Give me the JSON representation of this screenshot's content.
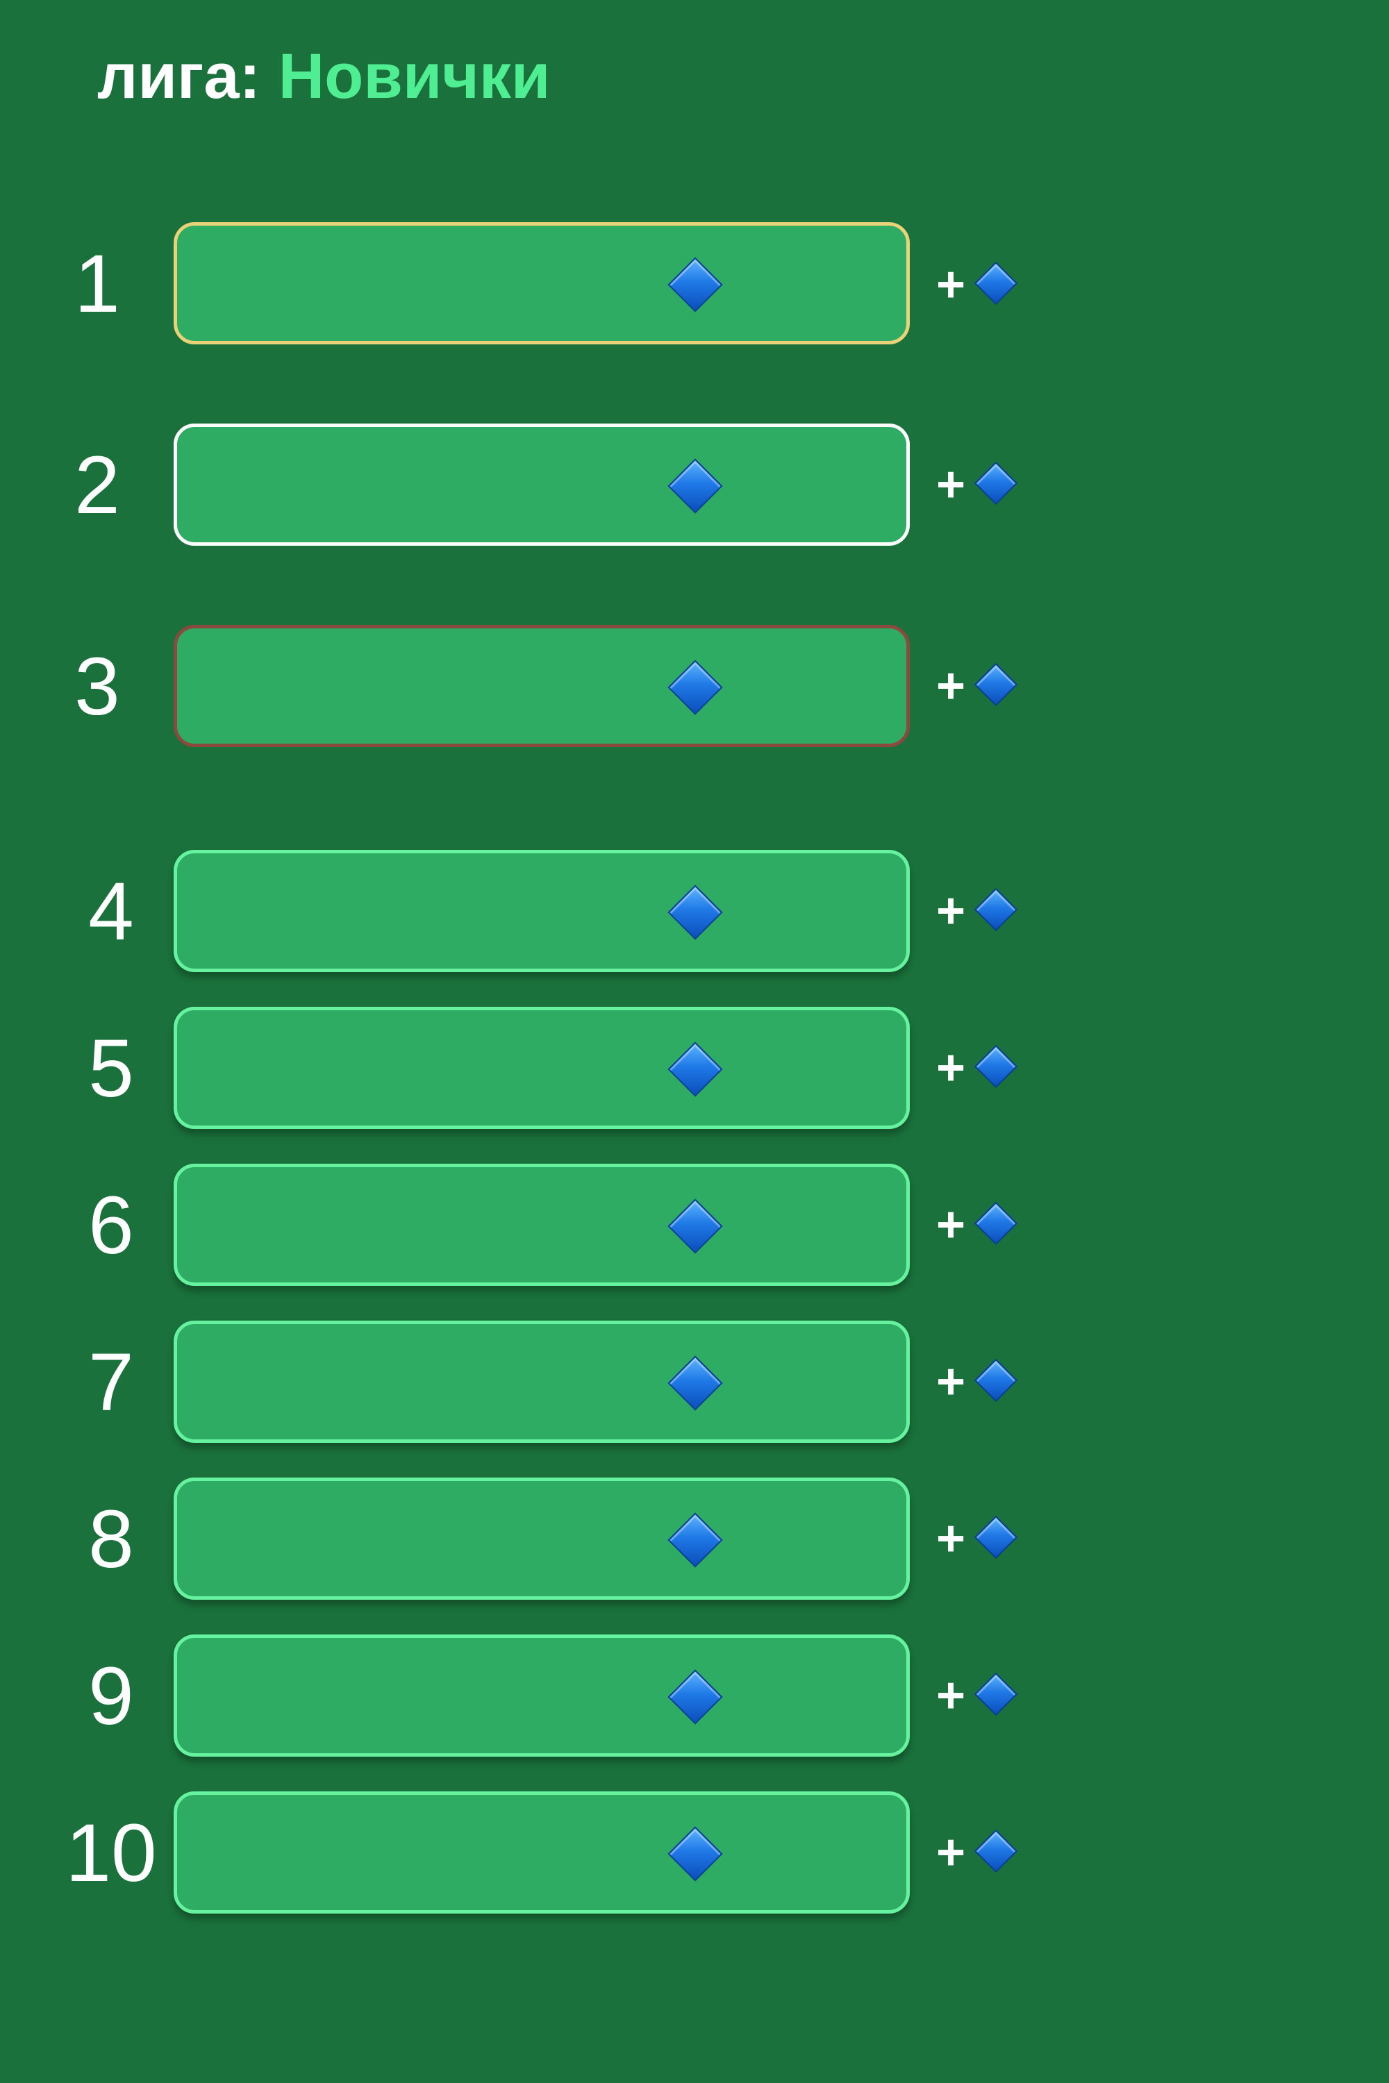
{
  "header": {
    "prefix": "лига:",
    "league_name": "Новички"
  },
  "colors": {
    "background": "#1a713b",
    "row_fill": "#2fac63",
    "row_border_default": "#66f29f",
    "row_border_gold": "#e9d277",
    "row_border_silver": "#ffffff",
    "row_border_bronze": "#8c4a3f",
    "league_name": "#4fee92"
  },
  "leaderboard": {
    "rows": [
      {
        "rank": "1",
        "name": "",
        "reward_prefix": "+",
        "reward_amount": "",
        "icon": "diamond-icon",
        "style": "gold"
      },
      {
        "rank": "2",
        "name": "",
        "reward_prefix": "+",
        "reward_amount": "",
        "icon": "diamond-icon",
        "style": "silver"
      },
      {
        "rank": "3",
        "name": "",
        "reward_prefix": "+",
        "reward_amount": "",
        "icon": "diamond-icon",
        "style": "bronze"
      },
      {
        "rank": "4",
        "name": "",
        "reward_prefix": "+",
        "reward_amount": "",
        "icon": "diamond-icon",
        "style": "default"
      },
      {
        "rank": "5",
        "name": "",
        "reward_prefix": "+",
        "reward_amount": "",
        "icon": "diamond-icon",
        "style": "default"
      },
      {
        "rank": "6",
        "name": "",
        "reward_prefix": "+",
        "reward_amount": "",
        "icon": "diamond-icon",
        "style": "default"
      },
      {
        "rank": "7",
        "name": "",
        "reward_prefix": "+",
        "reward_amount": "",
        "icon": "diamond-icon",
        "style": "default"
      },
      {
        "rank": "8",
        "name": "",
        "reward_prefix": "+",
        "reward_amount": "",
        "icon": "diamond-icon",
        "style": "default"
      },
      {
        "rank": "9",
        "name": "",
        "reward_prefix": "+",
        "reward_amount": "",
        "icon": "diamond-icon",
        "style": "default"
      },
      {
        "rank": "10",
        "name": "",
        "reward_prefix": "+",
        "reward_amount": "",
        "icon": "diamond-icon",
        "style": "default"
      }
    ]
  }
}
